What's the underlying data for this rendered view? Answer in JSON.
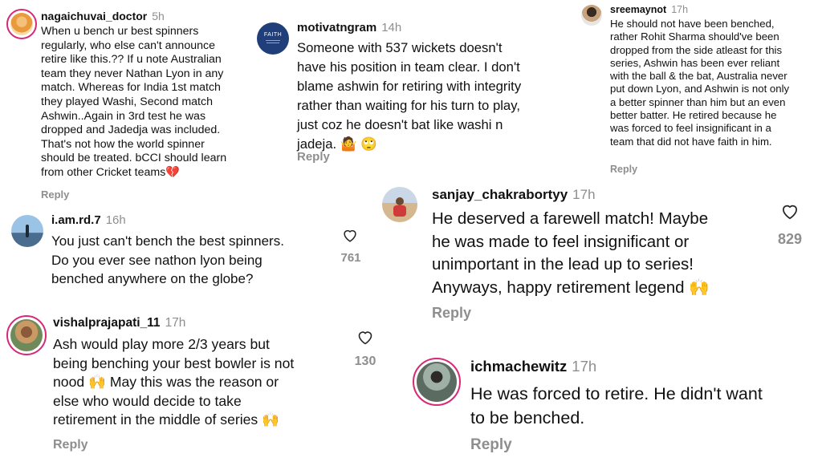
{
  "comments": [
    {
      "user": "nagaichuvai_doctor",
      "time": "5h",
      "lines": [
        "When u bench ur best spinners",
        "regularly, who else can't announce",
        "retire like this.?? If u note Australian",
        "team they never Nathan Lyon in any",
        "match. Whereas for India 1st match",
        "they played Washi, Second match",
        "Ashwin..Again in 3rd test he was",
        "dropped and Jadedja was included.",
        "That's not how the world spinner",
        "should be treated. bCCI should learn",
        "from other Cricket teams💔"
      ],
      "reply": "Reply"
    },
    {
      "user": "motivatngram",
      "time": "14h",
      "lines": [
        "Someone with 537 wickets doesn't",
        "have his position in team clear. I don't",
        "blame ashwin for retiring with integrity",
        "rather than waiting for his turn to play,",
        "just coz he doesn't bat like washi n",
        "jadeja. 🤷 🙄"
      ],
      "reply": "Reply",
      "avatar_text": "FAITH"
    },
    {
      "user": "sreemaynot",
      "time": "17h",
      "lines": [
        "He should not have been benched,",
        "rather Rohit Sharma should've been",
        "dropped from the side atleast for this",
        "series, Ashwin has been ever reliant",
        "with the ball & the bat, Australia never",
        "put down Lyon, and Ashwin is not only",
        "a better spinner than him but an even",
        "better batter. He retired because he",
        "was forced to feel insignificant in a",
        "team that did not have faith in him."
      ],
      "reply": "Reply"
    },
    {
      "user": "i.am.rd.7",
      "time": "16h",
      "lines": [
        "You just can't bench the best spinners.",
        "Do you ever see nathon lyon being",
        "benched anywhere on the globe?"
      ],
      "likes": "761"
    },
    {
      "user": "sanjay_chakrabortyy",
      "time": "17h",
      "lines": [
        "He deserved a farewell match! Maybe",
        "he was made to feel insignificant or",
        "unimportant in the lead up to series!",
        "Anyways, happy retirement legend 🙌"
      ],
      "reply": "Reply",
      "likes": "829"
    },
    {
      "user": "vishalprajapati_11",
      "time": "17h",
      "lines": [
        "Ash would play more 2/3 years but",
        "being benching your best bowler is not",
        "nood 🙌 May this was the reason or",
        "else who would decide  to take",
        "retirement in the middle of series 🙌"
      ],
      "reply": "Reply",
      "likes": "130"
    },
    {
      "user": "ichmachewitz",
      "time": "17h",
      "lines": [
        "He was forced to retire. He didn't want",
        "to be benched."
      ],
      "reply": "Reply"
    }
  ],
  "colors": {
    "text": "#111111",
    "muted": "#8e8e8e",
    "story_ring": "#d62976"
  },
  "icons": {
    "like": "heart-outline-icon"
  }
}
